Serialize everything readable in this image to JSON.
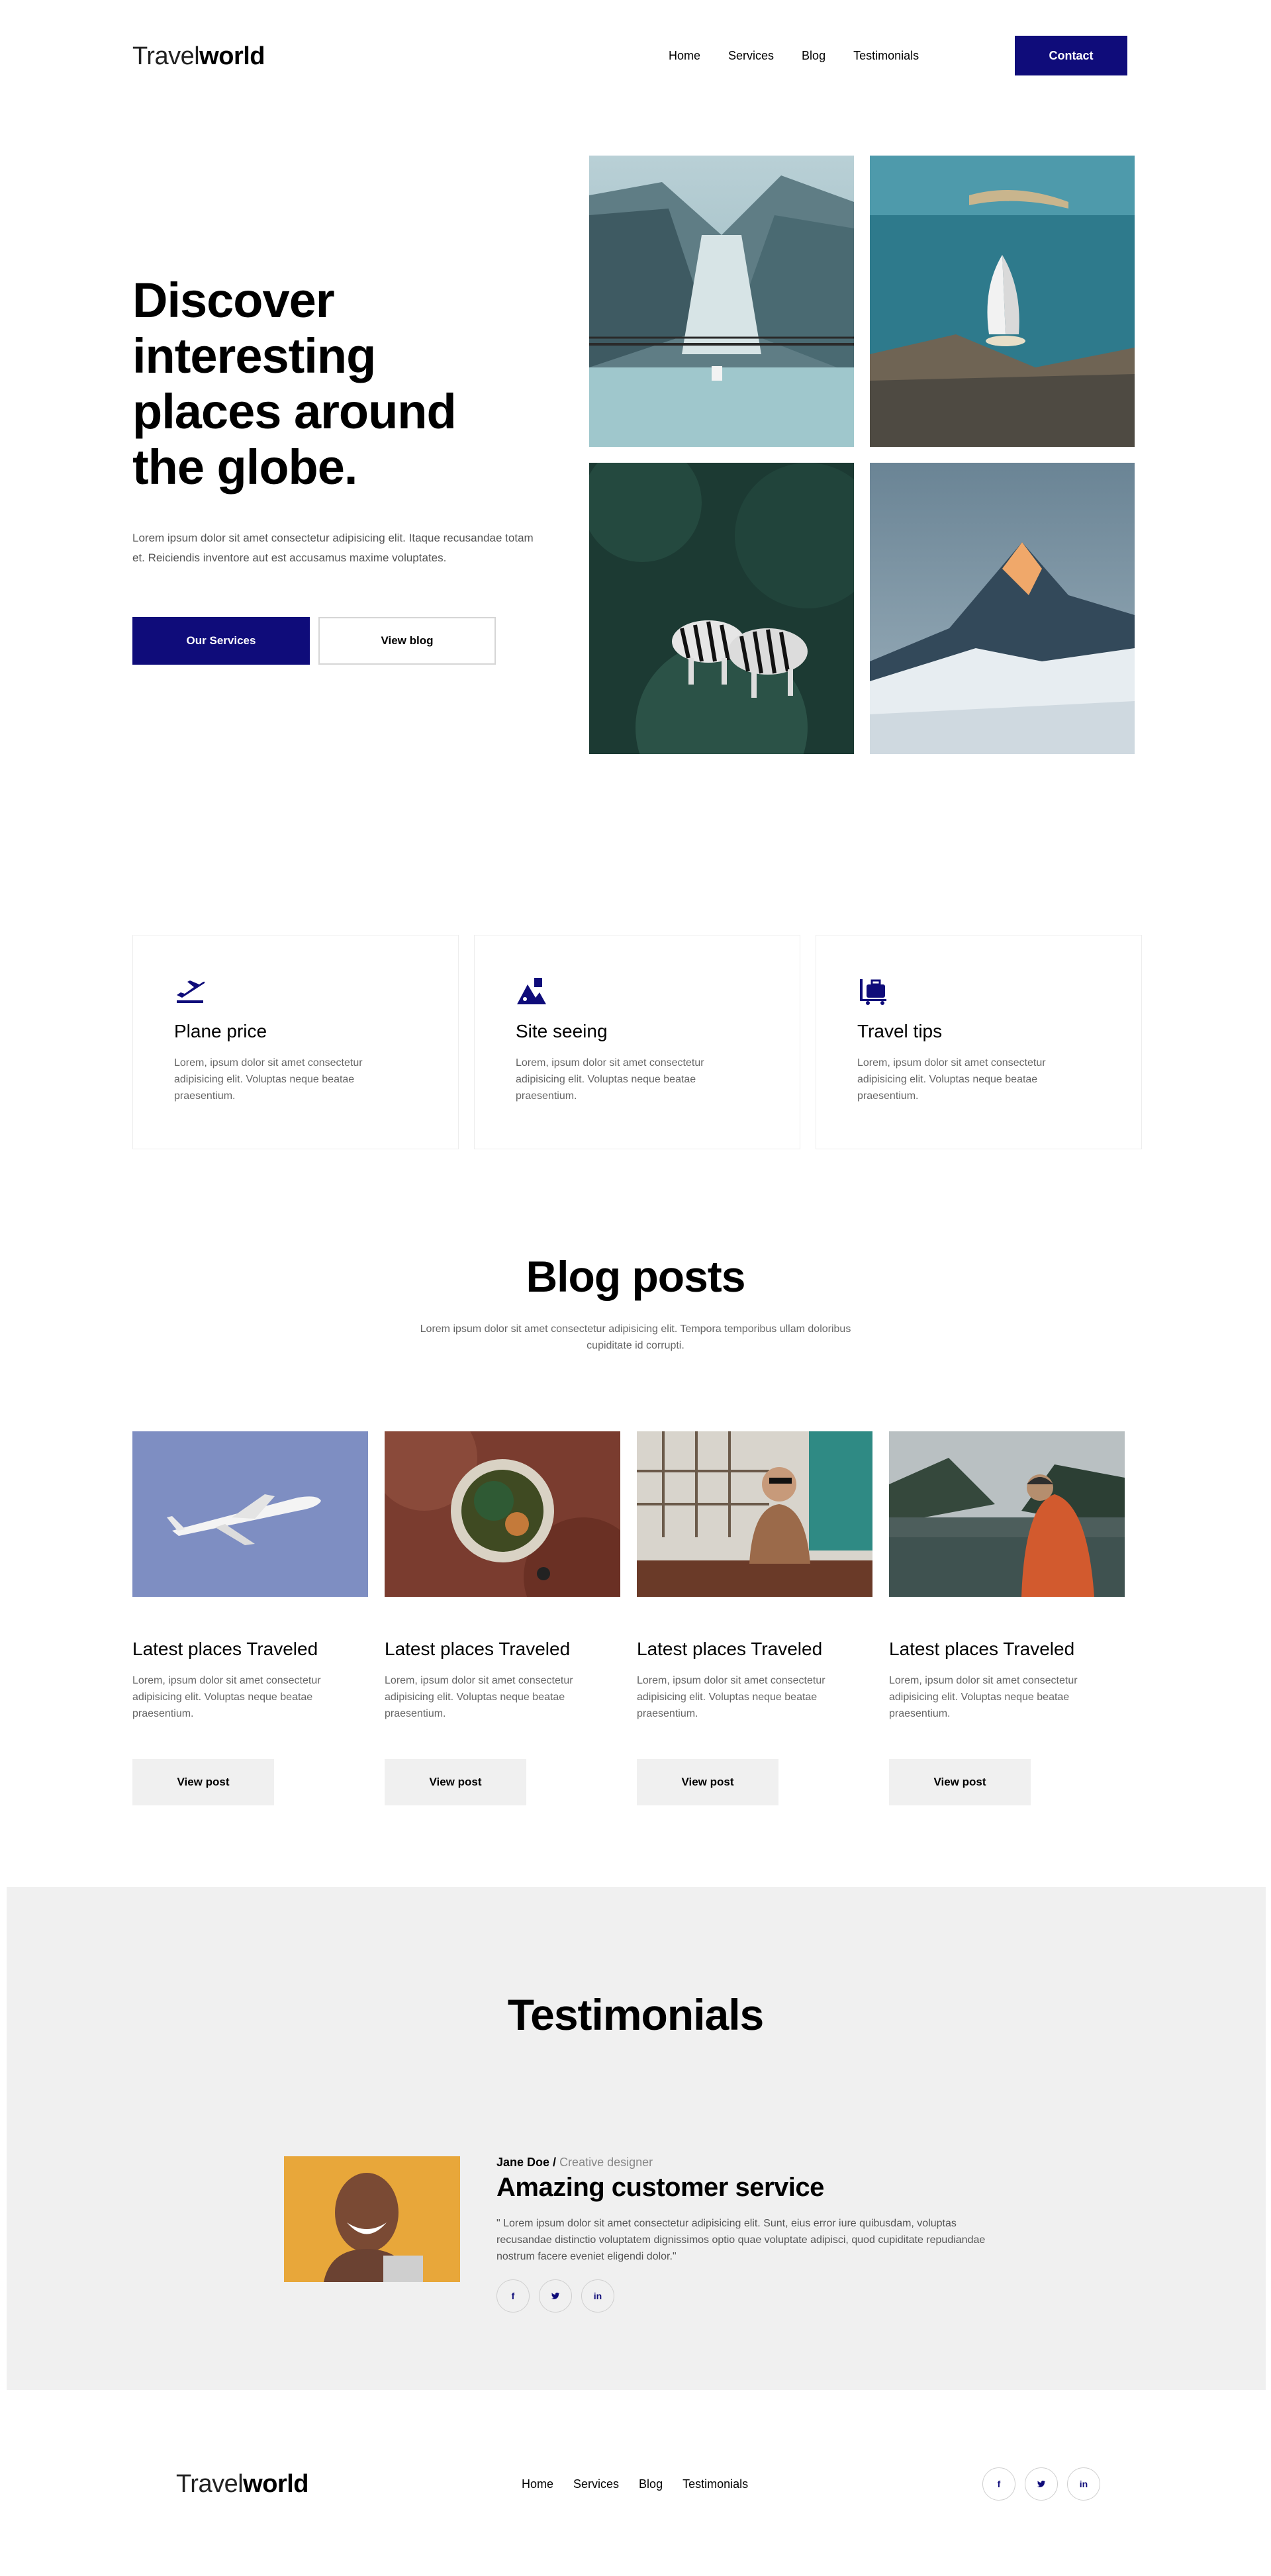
{
  "header": {
    "logo_light": "Travel",
    "logo_bold": "world",
    "nav": [
      "Home",
      "Services",
      "Blog",
      "Testimonials"
    ],
    "contact_label": "Contact"
  },
  "hero": {
    "title": "Discover interesting places around the globe.",
    "text": "Lorem ipsum dolor sit amet consectetur adipisicing elit. Itaque recusandae totam et. Reiciendis inventore aut est accusamus maxime voluptates.",
    "primary_label": "Our Services",
    "secondary_label": "View blog"
  },
  "features": [
    {
      "icon": "airplane-takeoff-icon",
      "title": "Plane price",
      "text": "Lorem, ipsum dolor sit amet consectetur adipisicing elit. Voluptas neque beatae praesentium."
    },
    {
      "icon": "map-landmark-icon",
      "title": "Site seeing",
      "text": "Lorem, ipsum dolor sit amet consectetur adipisicing elit. Voluptas neque beatae praesentium."
    },
    {
      "icon": "luggage-cart-icon",
      "title": "Travel tips",
      "text": "Lorem, ipsum dolor sit amet consectetur adipisicing elit. Voluptas neque beatae praesentium."
    }
  ],
  "blog": {
    "title": "Blog posts",
    "subtitle": "Lorem ipsum dolor sit amet consectetur adipisicing elit. Tempora temporibus ullam doloribus cupiditate id corrupti.",
    "posts": [
      {
        "title": "Latest places Traveled",
        "text": "Lorem, ipsum dolor sit amet consectetur adipisicing elit. Voluptas neque beatae praesentium.",
        "button": "View post"
      },
      {
        "title": "Latest places Traveled",
        "text": "Lorem, ipsum dolor sit amet consectetur adipisicing elit. Voluptas neque beatae praesentium.",
        "button": "View post"
      },
      {
        "title": "Latest places Traveled",
        "text": "Lorem, ipsum dolor sit amet consectetur adipisicing elit. Voluptas neque beatae praesentium.",
        "button": "View post"
      },
      {
        "title": "Latest places Traveled",
        "text": "Lorem, ipsum dolor sit amet consectetur adipisicing elit. Voluptas neque beatae praesentium.",
        "button": "View post"
      }
    ]
  },
  "testimonials": {
    "title": "Testimonials",
    "name": "Jane Doe /",
    "role": "Creative designer",
    "headline": "Amazing customer service",
    "quote": "\" Lorem ipsum dolor sit amet consectetur adipisicing elit. Sunt, eius error iure quibusdam, voluptas recusandae distinctio voluptatem dignissimos optio quae voluptate adipisci, quod cupiditate repudiandae nostrum facere eveniet eligendi dolor.\"",
    "social": [
      "f",
      "t",
      "in"
    ]
  },
  "footer": {
    "logo_light": "Travel",
    "logo_bold": "world",
    "nav": [
      "Home",
      "Services",
      "Blog",
      "Testimonials"
    ],
    "social": [
      "f",
      "t",
      "in"
    ]
  },
  "colors": {
    "brand": "#0f0c7a",
    "text_muted": "#666666",
    "section_bg": "#f0f0f0"
  }
}
